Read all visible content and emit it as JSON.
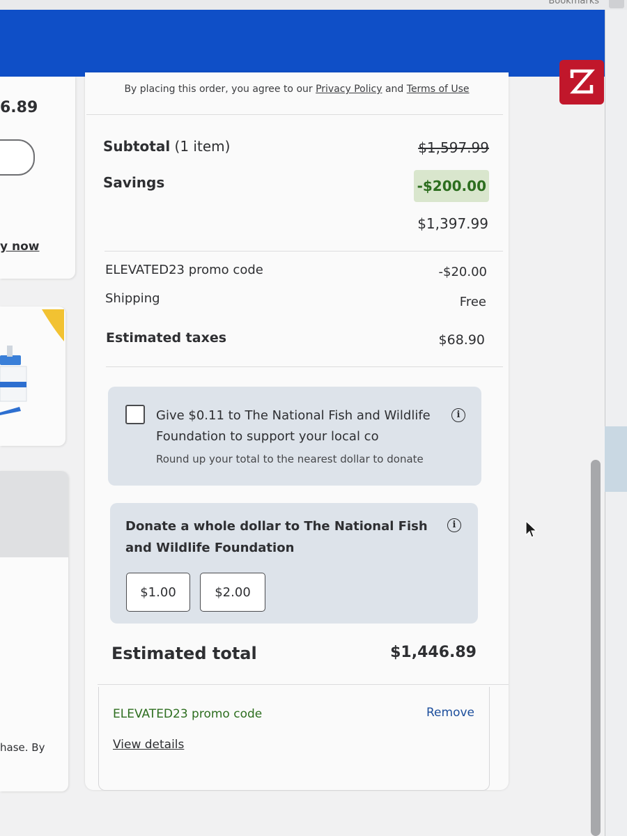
{
  "browser": {
    "bookmarks_label": "Bookmarks"
  },
  "left_column": {
    "amount_fragment": "6.89",
    "link_fragment": "y now",
    "text_fragment": "hase. By"
  },
  "legal": {
    "prefix": "By placing this order, you agree to our ",
    "privacy_policy": "Privacy Policy",
    "and": " and ",
    "terms_of_use": "Terms of Use"
  },
  "summary": {
    "subtotal_label": "Subtotal",
    "subtotal_items": "(1 item)",
    "subtotal_original": "$1,597.99",
    "savings_label": "Savings",
    "savings_value": "-$200.00",
    "subtotal_after_savings": "$1,397.99",
    "promo_label": "ELEVATED23 promo code",
    "promo_value": "-$20.00",
    "shipping_label": "Shipping",
    "shipping_value": "Free",
    "taxes_label": "Estimated taxes",
    "taxes_value": "$68.90"
  },
  "round_up": {
    "text": "Give $0.11 to The National Fish and Wildlife Foundation to support your local co",
    "subtext": "Round up your total to the nearest dollar to donate",
    "checked": false,
    "info_glyph": "i"
  },
  "whole_dollar": {
    "text": "Donate a whole dollar to The National Fish and Wildlife Foundation",
    "options": [
      "$1.00",
      "$2.00"
    ],
    "info_glyph": "i"
  },
  "total": {
    "label": "Estimated total",
    "value": "$1,446.89"
  },
  "applied_promo": {
    "label": "ELEVATED23 promo code",
    "remove": "Remove",
    "view_details": "View details"
  },
  "icons": {
    "zoom_badge": "zoom-extension-icon",
    "info": "info-icon",
    "cursor": "mouse-cursor-icon"
  },
  "colors": {
    "header_blue": "#0f4fc7",
    "savings_green": "#2d6e1f",
    "savings_badge_bg": "#d9e6cd",
    "donation_box_bg": "#dde3ea",
    "remove_link_blue": "#1c4e9c",
    "zoom_badge_red": "#c1172b"
  }
}
